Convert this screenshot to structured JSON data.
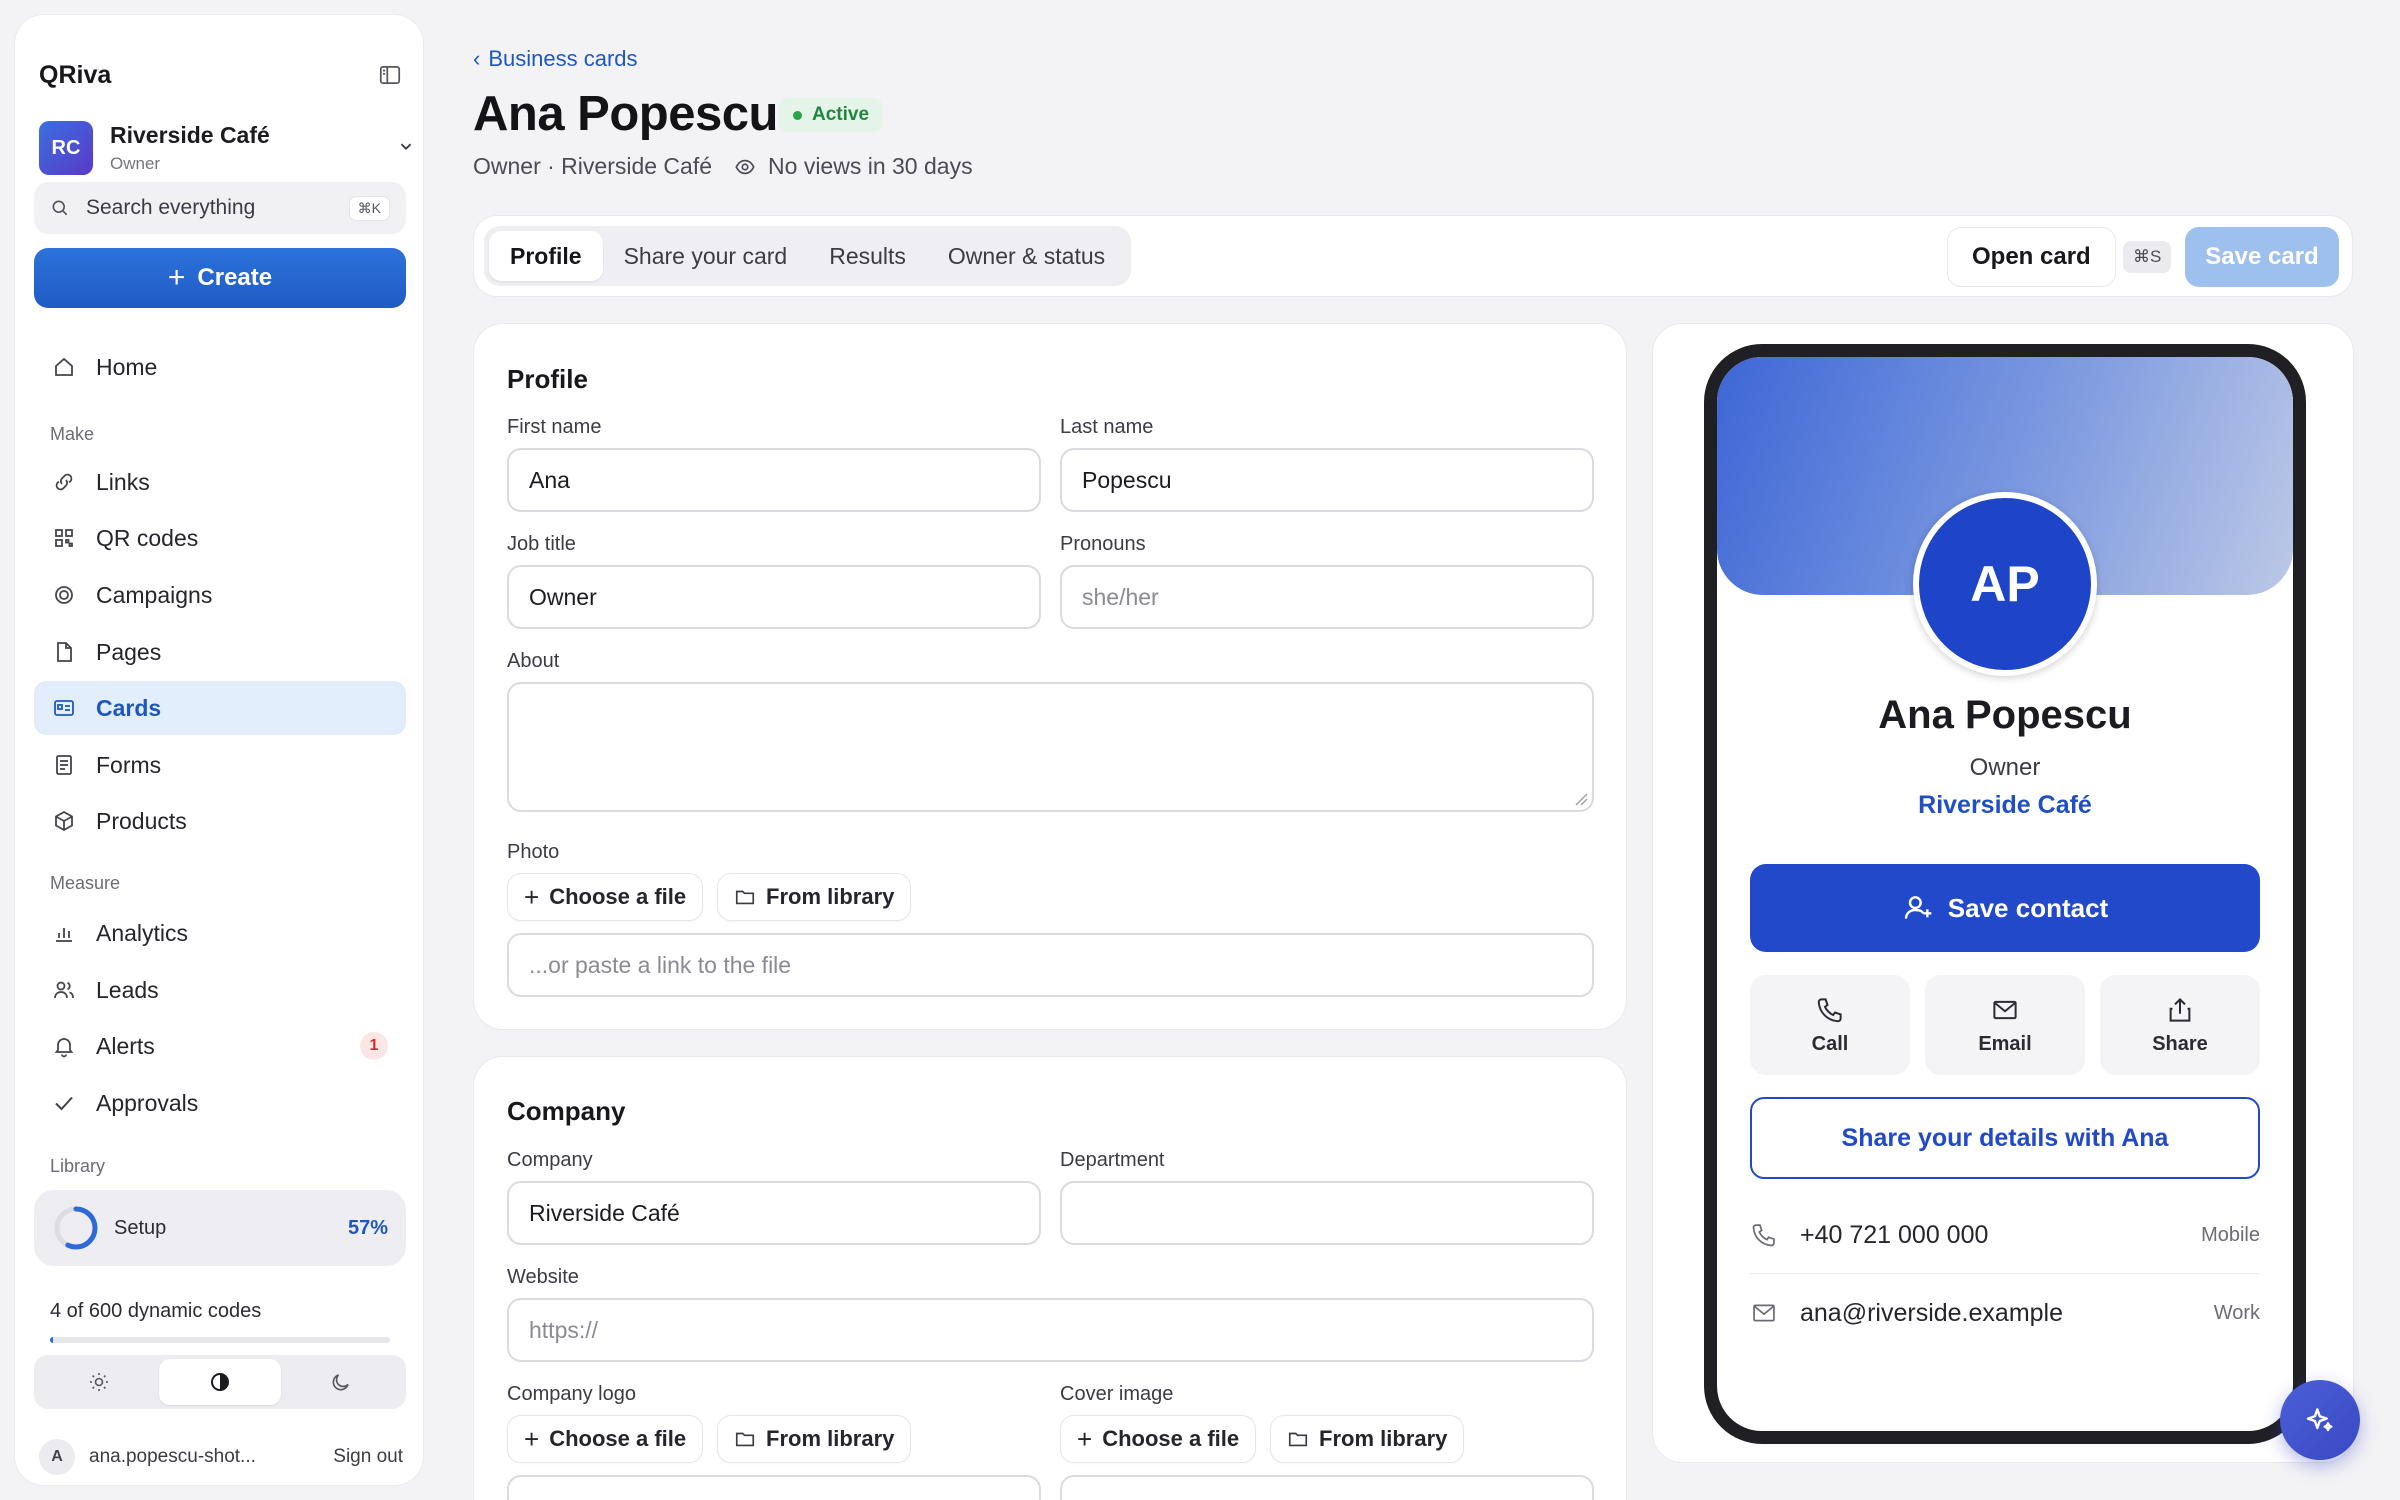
{
  "app": {
    "name": "QRiva"
  },
  "workspace": {
    "initials": "RC",
    "name": "Riverside Café",
    "role": "Owner"
  },
  "search": {
    "placeholder": "Search everything",
    "shortcut": "⌘K"
  },
  "create_label": "Create",
  "nav": {
    "home": "Home",
    "section_make": "Make",
    "links": "Links",
    "qr_codes": "QR codes",
    "campaigns": "Campaigns",
    "pages": "Pages",
    "cards": "Cards",
    "forms": "Forms",
    "products": "Products",
    "section_measure": "Measure",
    "analytics": "Analytics",
    "leads": "Leads",
    "alerts": "Alerts",
    "alerts_badge": "1",
    "approvals": "Approvals",
    "section_library": "Library"
  },
  "setup": {
    "label": "Setup",
    "percent_label": "57%",
    "percent": 0.57
  },
  "codes": {
    "label": "4 of 600 dynamic codes",
    "used": 4,
    "total": 600
  },
  "theme": {
    "selected": "contrast"
  },
  "user": {
    "initial": "A",
    "email": "ana.popescu-shot...",
    "signout": "Sign out"
  },
  "header": {
    "breadcrumb": "Business cards",
    "title": "Ana Popescu",
    "status": "Active",
    "subtitle": "Owner · Riverside Café",
    "views": "No views in 30 days"
  },
  "tabs": [
    "Profile",
    "Share your card",
    "Results",
    "Owner & status"
  ],
  "actions": {
    "open_card": "Open card",
    "shortcut": "⌘S",
    "save_card": "Save card"
  },
  "profile": {
    "title": "Profile",
    "first_name_label": "First name",
    "first_name": "Ana",
    "last_name_label": "Last name",
    "last_name": "Popescu",
    "job_title_label": "Job title",
    "job_title": "Owner",
    "pronouns_label": "Pronouns",
    "pronouns_placeholder": "she/her",
    "about_label": "About",
    "photo_label": "Photo",
    "choose_file": "Choose a file",
    "from_library": "From library",
    "link_placeholder": "...or paste a link to the file"
  },
  "company": {
    "title": "Company",
    "company_label": "Company",
    "company": "Riverside Café",
    "department_label": "Department",
    "website_label": "Website",
    "website_placeholder": "https://",
    "logo_label": "Company logo",
    "cover_label": "Cover image",
    "choose_file": "Choose a file",
    "from_library": "From library"
  },
  "preview": {
    "initials": "AP",
    "name": "Ana Popescu",
    "role": "Owner",
    "company": "Riverside Café",
    "save_contact": "Save contact",
    "call": "Call",
    "email": "Email",
    "share": "Share",
    "share_details": "Share your details with Ana",
    "phone": "+40 721 000 000",
    "phone_type": "Mobile",
    "email_address": "ana@riverside.example",
    "email_type": "Work"
  },
  "colors": {
    "accent": "#1f57c0",
    "primary_button": "#2149c9",
    "active_status": "#22873e"
  }
}
